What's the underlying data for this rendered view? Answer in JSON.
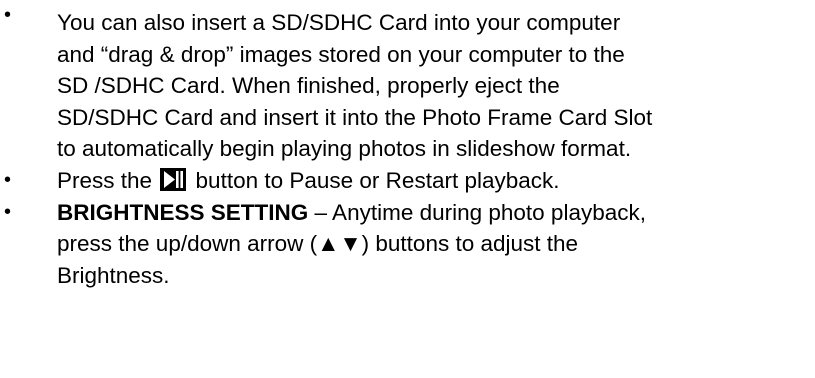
{
  "bullet_glyph": "•",
  "items": [
    {
      "text": "You can also insert a SD/SDHC Card into your computer and “drag & drop” images stored on your computer to the SD /SDHC Card. When finished, properly eject the SD/SDHC Card and insert it into the Photo Frame Card Slot to automatically begin playing photos in slideshow format.",
      "lines": [
        "You can also insert a SD/SDHC Card into your computer",
        "and “drag & drop” images stored on your computer to the",
        "SD /SDHC Card. When finished, properly eject the",
        "SD/SDHC Card and insert it into the Photo Frame Card Slot",
        "to automatically begin playing photos in slideshow format."
      ]
    },
    {
      "before_icon": "Press the ",
      "icon": "play-pause-icon",
      "after_icon": " button to Pause or Restart playback."
    },
    {
      "bold_lead": "BRIGHTNESS SETTING",
      "lines": [
        " – Anytime during photo playback,",
        "press the up/down arrow (▲▼) buttons to adjust the",
        "Brightness."
      ]
    }
  ]
}
